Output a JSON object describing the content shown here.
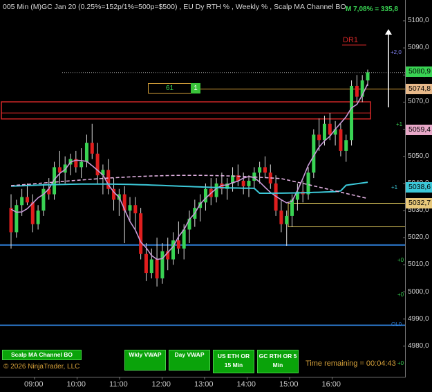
{
  "chart_title": "005 Min (M)GC Jan 20  (0.25%=152p/1%=500p=$500) , EU Dy RTH % , Weekly % , Scalp MA Channel BO",
  "header_stat": "M 7,08% = 335,8",
  "y_ticks": [
    "5100,0",
    "5090,0",
    "5080,0",
    "5070,0",
    "5060,0",
    "5050,0",
    "5040,0",
    "5030,0",
    "5020,0",
    "5010,0",
    "5000,0",
    "4990,0",
    "4980,0"
  ],
  "x_ticks": [
    "09:00",
    "10:00",
    "11:00",
    "12:00",
    "13:00",
    "14:00",
    "15:00",
    "16:00"
  ],
  "price_markers": {
    "last": "5080,9",
    "level_1": "5074,8",
    "level_2": "5059,4",
    "level_3": "5038,6",
    "level_4": "5032,7"
  },
  "dr_label": "DR1",
  "fib_label": "61",
  "fib_marker": "1",
  "small_labels": {
    "a": "+2,0",
    "b": "+1",
    "c": "+1",
    "d": "+0",
    "e": "+0",
    "f": "+0",
    "g": "OL0"
  },
  "buttons": {
    "scalp": "Scalp MA Channel BO",
    "wkly": "Wkly VWAP",
    "day": "Day VWAP",
    "us_eth": "US ETH OR 15 Min",
    "gc_rth": "GC RTH OR 5 Min"
  },
  "copyright": "© 2026 NinjaTrader, LLC",
  "time_remaining": "Time remaining = 00:04:43",
  "colors": {
    "up": "#39d353",
    "down": "#e01e1e",
    "vwap_cyan": "#3cc8d8",
    "ma_violet": "#c89ad8",
    "blue_line": "#2f7fd8",
    "orange": "#d6a13a",
    "red_box": "#d62828"
  },
  "chart_data": {
    "type": "candlestick",
    "instrument": "(M)GC Jan 20",
    "interval": "5 Min",
    "ylim": [
      4975,
      5104
    ],
    "candles": [
      {
        "o": 5031,
        "h": 5036,
        "l": 5016,
        "c": 5022
      },
      {
        "o": 5022,
        "h": 5034,
        "l": 5020,
        "c": 5032
      },
      {
        "o": 5032,
        "h": 5038,
        "l": 5028,
        "c": 5035
      },
      {
        "o": 5035,
        "h": 5040,
        "l": 5032,
        "c": 5033
      },
      {
        "o": 5033,
        "h": 5036,
        "l": 5022,
        "c": 5025
      },
      {
        "o": 5025,
        "h": 5032,
        "l": 5023,
        "c": 5030
      },
      {
        "o": 5030,
        "h": 5040,
        "l": 5028,
        "c": 5038
      },
      {
        "o": 5038,
        "h": 5042,
        "l": 5034,
        "c": 5036
      },
      {
        "o": 5036,
        "h": 5048,
        "l": 5034,
        "c": 5046
      },
      {
        "o": 5046,
        "h": 5052,
        "l": 5040,
        "c": 5044
      },
      {
        "o": 5044,
        "h": 5050,
        "l": 5040,
        "c": 5047
      },
      {
        "o": 5047,
        "h": 5051,
        "l": 5043,
        "c": 5049
      },
      {
        "o": 5049,
        "h": 5052,
        "l": 5044,
        "c": 5046
      },
      {
        "o": 5046,
        "h": 5053,
        "l": 5042,
        "c": 5048
      },
      {
        "o": 5048,
        "h": 5058,
        "l": 5046,
        "c": 5055
      },
      {
        "o": 5055,
        "h": 5062,
        "l": 5049,
        "c": 5051
      },
      {
        "o": 5051,
        "h": 5055,
        "l": 5040,
        "c": 5043
      },
      {
        "o": 5043,
        "h": 5047,
        "l": 5036,
        "c": 5045
      },
      {
        "o": 5045,
        "h": 5049,
        "l": 5036,
        "c": 5038
      },
      {
        "o": 5038,
        "h": 5042,
        "l": 5030,
        "c": 5034
      },
      {
        "o": 5034,
        "h": 5038,
        "l": 5028,
        "c": 5036
      },
      {
        "o": 5036,
        "h": 5039,
        "l": 5018,
        "c": 5030
      },
      {
        "o": 5030,
        "h": 5035,
        "l": 5026,
        "c": 5032
      },
      {
        "o": 5032,
        "h": 5035,
        "l": 5023,
        "c": 5029
      },
      {
        "o": 5029,
        "h": 5031,
        "l": 5012,
        "c": 5014
      },
      {
        "o": 5014,
        "h": 5018,
        "l": 5004,
        "c": 5007
      },
      {
        "o": 5007,
        "h": 5016,
        "l": 5005,
        "c": 5012
      },
      {
        "o": 5012,
        "h": 5020,
        "l": 5002,
        "c": 5005
      },
      {
        "o": 5005,
        "h": 5018,
        "l": 5003,
        "c": 5015
      },
      {
        "o": 5015,
        "h": 5020,
        "l": 5008,
        "c": 5012
      },
      {
        "o": 5012,
        "h": 5022,
        "l": 5010,
        "c": 5019
      },
      {
        "o": 5019,
        "h": 5026,
        "l": 5014,
        "c": 5016
      },
      {
        "o": 5016,
        "h": 5025,
        "l": 5012,
        "c": 5023
      },
      {
        "o": 5023,
        "h": 5030,
        "l": 5018,
        "c": 5027
      },
      {
        "o": 5027,
        "h": 5034,
        "l": 5024,
        "c": 5031
      },
      {
        "o": 5031,
        "h": 5036,
        "l": 5026,
        "c": 5033
      },
      {
        "o": 5033,
        "h": 5040,
        "l": 5030,
        "c": 5038
      },
      {
        "o": 5038,
        "h": 5042,
        "l": 5032,
        "c": 5035
      },
      {
        "o": 5035,
        "h": 5042,
        "l": 5033,
        "c": 5040
      },
      {
        "o": 5040,
        "h": 5044,
        "l": 5036,
        "c": 5038
      },
      {
        "o": 5038,
        "h": 5042,
        "l": 5034,
        "c": 5040
      },
      {
        "o": 5040,
        "h": 5046,
        "l": 5037,
        "c": 5043
      },
      {
        "o": 5043,
        "h": 5047,
        "l": 5039,
        "c": 5041
      },
      {
        "o": 5041,
        "h": 5044,
        "l": 5036,
        "c": 5039
      },
      {
        "o": 5039,
        "h": 5043,
        "l": 5035,
        "c": 5041
      },
      {
        "o": 5041,
        "h": 5046,
        "l": 5038,
        "c": 5044
      },
      {
        "o": 5044,
        "h": 5048,
        "l": 5040,
        "c": 5046
      },
      {
        "o": 5046,
        "h": 5050,
        "l": 5042,
        "c": 5044
      },
      {
        "o": 5044,
        "h": 5047,
        "l": 5038,
        "c": 5040
      },
      {
        "o": 5040,
        "h": 5043,
        "l": 5028,
        "c": 5030
      },
      {
        "o": 5030,
        "h": 5034,
        "l": 5022,
        "c": 5025
      },
      {
        "o": 5025,
        "h": 5030,
        "l": 5017,
        "c": 5028
      },
      {
        "o": 5028,
        "h": 5036,
        "l": 5024,
        "c": 5034
      },
      {
        "o": 5034,
        "h": 5040,
        "l": 5030,
        "c": 5037
      },
      {
        "o": 5037,
        "h": 5041,
        "l": 5033,
        "c": 5036
      },
      {
        "o": 5036,
        "h": 5046,
        "l": 5034,
        "c": 5044
      },
      {
        "o": 5044,
        "h": 5060,
        "l": 5042,
        "c": 5058
      },
      {
        "o": 5058,
        "h": 5064,
        "l": 5052,
        "c": 5056
      },
      {
        "o": 5056,
        "h": 5065,
        "l": 5054,
        "c": 5062
      },
      {
        "o": 5062,
        "h": 5066,
        "l": 5056,
        "c": 5058
      },
      {
        "o": 5058,
        "h": 5063,
        "l": 5054,
        "c": 5060
      },
      {
        "o": 5060,
        "h": 5062,
        "l": 5050,
        "c": 5052
      },
      {
        "o": 5052,
        "h": 5058,
        "l": 5048,
        "c": 5056
      },
      {
        "o": 5056,
        "h": 5078,
        "l": 5054,
        "c": 5076
      },
      {
        "o": 5076,
        "h": 5080,
        "l": 5070,
        "c": 5072
      },
      {
        "o": 5072,
        "h": 5080,
        "l": 5070,
        "c": 5078
      },
      {
        "o": 5078,
        "h": 5082,
        "l": 5076,
        "c": 5081
      }
    ],
    "levels": [
      {
        "name": "last",
        "y": 5080.9
      },
      {
        "name": "level_1",
        "y": 5074.8
      },
      {
        "name": "level_2",
        "y": 5059.4
      },
      {
        "name": "level_3",
        "y": 5038.6
      },
      {
        "name": "level_4",
        "y": 5032.7
      },
      {
        "name": "blue_upper",
        "y": 5017.3
      },
      {
        "name": "blue_lower",
        "y": 4987.7
      }
    ],
    "red_zone": [
      5063.8,
      5070.1
    ]
  }
}
